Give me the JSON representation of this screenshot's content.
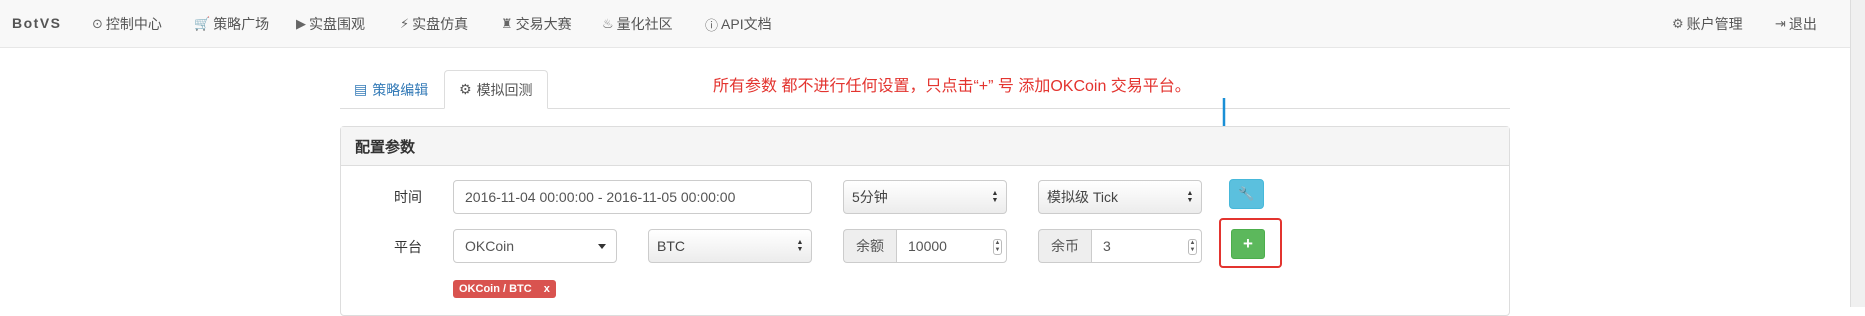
{
  "navbar": {
    "brand": "BotVS",
    "items": [
      {
        "icon": "clock-icon",
        "glyph": "⊙",
        "label": "控制中心"
      },
      {
        "icon": "cart-icon",
        "glyph": "🛒",
        "label": "策略广场"
      },
      {
        "icon": "play-circle-icon",
        "glyph": "▶",
        "label": "实盘围观"
      },
      {
        "icon": "bolt-icon",
        "glyph": "⚡",
        "label": "实盘仿真"
      },
      {
        "icon": "tower-icon",
        "glyph": "♜",
        "label": "交易大赛"
      },
      {
        "icon": "fire-icon",
        "glyph": "♨",
        "label": "量化社区"
      },
      {
        "icon": "info-icon",
        "glyph": "ⓘ",
        "label": "API文档"
      }
    ],
    "right_items": [
      {
        "icon": "gear-icon",
        "glyph": "⚙",
        "label": "账户管理"
      },
      {
        "icon": "logout-icon",
        "glyph": "⇥",
        "label": "退出"
      }
    ]
  },
  "tabs": [
    {
      "icon": "file-icon",
      "glyph": "▤",
      "label": "策略编辑"
    },
    {
      "icon": "cogs-icon",
      "glyph": "⚙",
      "label": "模拟回测",
      "active": true
    }
  ],
  "annotation": "所有参数 都不进行任何设置，只点击“+” 号 添加OKCoin 交易平台。",
  "panel": {
    "title": "配置参数",
    "time_label": "时间",
    "time_range": "2016-11-04 00:00:00 - 2016-11-05 00:00:00",
    "period": "5分钟",
    "tick_mode": "模拟级 Tick",
    "platform_label": "平台",
    "exchange": "OKCoin",
    "symbol": "BTC",
    "balance_label": "余额",
    "balance": "10000",
    "coins_label": "余币",
    "coins": "3",
    "add_button": "+",
    "wrench_glyph": "🔧",
    "platform_tag": "OKCoin / BTC",
    "platform_tag_remove": "x"
  },
  "colors": {
    "primary": "#337ab7",
    "success": "#5cb85c",
    "info": "#5bc0de",
    "danger": "#d9534f",
    "annotation_red": "#e3342f",
    "arrow_blue": "#1a8fd6"
  }
}
